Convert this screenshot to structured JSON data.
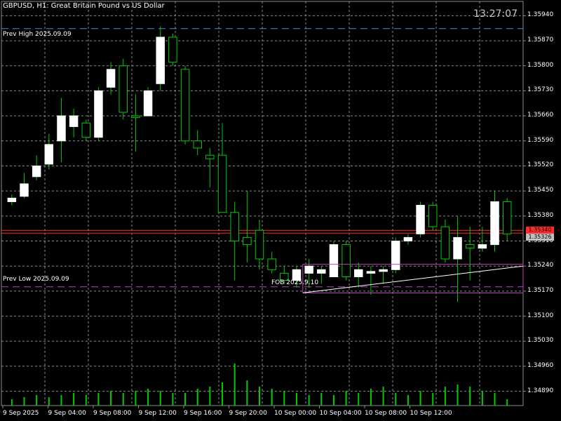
{
  "title": "GBPUSD, H1:  Great Britain Pound vs US Dollar",
  "clock": "13:27:07",
  "lines": {
    "prev_high": {
      "label": "Prev High 2025.09.09",
      "price": 1.35904,
      "color": "#4a86e8"
    },
    "prev_low": {
      "label": "Prev Low 2025.09.09",
      "price": 1.35182,
      "color": "#c040c0"
    },
    "fob": {
      "label": "FOB 2025.9.10"
    },
    "red_level": {
      "price": 1.3534,
      "color": "#ff2a2a"
    }
  },
  "price_axis": {
    "labels": [
      "1.35940",
      "1.35870",
      "1.35800",
      "1.35730",
      "1.35660",
      "1.35590",
      "1.35520",
      "1.35450",
      "1.35380",
      "1.35310",
      "1.35240",
      "1.35170",
      "1.35100",
      "1.35030",
      "1.34960",
      "1.34890"
    ],
    "tags": [
      {
        "text": "1.35340",
        "bg": "#ff2a2a"
      },
      {
        "text": "1.35326",
        "bg": "#c0c0c0"
      }
    ]
  },
  "time_axis": [
    "9 Sep 2025",
    "9 Sep 04:00",
    "9 Sep 08:00",
    "9 Sep 12:00",
    "9 Sep 16:00",
    "9 Sep 20:00",
    "10 Sep 00:00",
    "10 Sep 04:00",
    "10 Sep 08:00",
    "10 Sep 12:00"
  ],
  "colors": {
    "background": "#000000",
    "grid": "#8c8c8c",
    "bull_body": "#ffffff",
    "wick": "#00cc00",
    "volume": "#00cc00",
    "fob_line": "#ffffff"
  },
  "chart_data": {
    "type": "candlestick",
    "symbol": "GBPUSD",
    "timeframe": "H1",
    "price_range": [
      1.3485,
      1.3598
    ],
    "candles": [
      {
        "o": 1.3542,
        "h": 1.3544,
        "l": 1.3541,
        "c": 1.3543
      },
      {
        "o": 1.35435,
        "h": 1.355,
        "l": 1.3543,
        "c": 1.3547
      },
      {
        "o": 1.3549,
        "h": 1.3555,
        "l": 1.3548,
        "c": 1.3552
      },
      {
        "o": 1.35525,
        "h": 1.3561,
        "l": 1.3551,
        "c": 1.3558
      },
      {
        "o": 1.3559,
        "h": 1.3571,
        "l": 1.3553,
        "c": 1.3566
      },
      {
        "o": 1.3563,
        "h": 1.3568,
        "l": 1.356,
        "c": 1.3566
      },
      {
        "o": 1.3564,
        "h": 1.3565,
        "l": 1.3559,
        "c": 1.356
      },
      {
        "o": 1.356,
        "h": 1.3574,
        "l": 1.3559,
        "c": 1.3573
      },
      {
        "o": 1.3574,
        "h": 1.3581,
        "l": 1.3572,
        "c": 1.3579
      },
      {
        "o": 1.358,
        "h": 1.3582,
        "l": 1.3565,
        "c": 1.3567
      },
      {
        "o": 1.3566,
        "h": 1.3572,
        "l": 1.3556,
        "c": 1.35655
      },
      {
        "o": 1.3566,
        "h": 1.3574,
        "l": 1.3566,
        "c": 1.3573
      },
      {
        "o": 1.3575,
        "h": 1.3591,
        "l": 1.3573,
        "c": 1.3588
      },
      {
        "o": 1.3588,
        "h": 1.3589,
        "l": 1.358,
        "c": 1.3581
      },
      {
        "o": 1.3579,
        "h": 1.358,
        "l": 1.3558,
        "c": 1.3559
      },
      {
        "o": 1.3559,
        "h": 1.3562,
        "l": 1.3555,
        "c": 1.3557
      },
      {
        "o": 1.3555,
        "h": 1.3557,
        "l": 1.3546,
        "c": 1.3554
      },
      {
        "o": 1.3555,
        "h": 1.3564,
        "l": 1.3548,
        "c": 1.3539
      },
      {
        "o": 1.3539,
        "h": 1.3542,
        "l": 1.352,
        "c": 1.3531
      },
      {
        "o": 1.3532,
        "h": 1.3545,
        "l": 1.3525,
        "c": 1.353
      },
      {
        "o": 1.3534,
        "h": 1.3537,
        "l": 1.3523,
        "c": 1.3526
      },
      {
        "o": 1.3526,
        "h": 1.3528,
        "l": 1.3522,
        "c": 1.3523
      },
      {
        "o": 1.3522,
        "h": 1.3524,
        "l": 1.3519,
        "c": 1.352
      },
      {
        "o": 1.352,
        "h": 1.3524,
        "l": 1.3518,
        "c": 1.3523
      },
      {
        "o": 1.3522,
        "h": 1.3526,
        "l": 1.3518,
        "c": 1.3524
      },
      {
        "o": 1.3522,
        "h": 1.3524,
        "l": 1.3519,
        "c": 1.3523
      },
      {
        "o": 1.3521,
        "h": 1.3531,
        "l": 1.3521,
        "c": 1.353
      },
      {
        "o": 1.353,
        "h": 1.3531,
        "l": 1.352,
        "c": 1.3521
      },
      {
        "o": 1.3521,
        "h": 1.3525,
        "l": 1.3518,
        "c": 1.3523
      },
      {
        "o": 1.3522,
        "h": 1.3524,
        "l": 1.3516,
        "c": 1.35225
      },
      {
        "o": 1.35225,
        "h": 1.3524,
        "l": 1.3519,
        "c": 1.3523
      },
      {
        "o": 1.3523,
        "h": 1.3532,
        "l": 1.3522,
        "c": 1.3531
      },
      {
        "o": 1.3531,
        "h": 1.3533,
        "l": 1.353,
        "c": 1.3532
      },
      {
        "o": 1.3533,
        "h": 1.3542,
        "l": 1.3532,
        "c": 1.3541
      },
      {
        "o": 1.3541,
        "h": 1.3542,
        "l": 1.3534,
        "c": 1.3535
      },
      {
        "o": 1.3535,
        "h": 1.3537,
        "l": 1.3525,
        "c": 1.3526
      },
      {
        "o": 1.3526,
        "h": 1.3538,
        "l": 1.3514,
        "c": 1.3532
      },
      {
        "o": 1.353,
        "h": 1.3535,
        "l": 1.352,
        "c": 1.3529
      },
      {
        "o": 1.3529,
        "h": 1.3535,
        "l": 1.3528,
        "c": 1.353
      },
      {
        "o": 1.353,
        "h": 1.3545,
        "l": 1.3528,
        "c": 1.3542
      },
      {
        "o": 1.3542,
        "h": 1.3543,
        "l": 1.3531,
        "c": 1.3533
      }
    ],
    "volumes": [
      3,
      4,
      5,
      4,
      5,
      6,
      5,
      6,
      7,
      6,
      7,
      8,
      7,
      6,
      6,
      8,
      9,
      11,
      20,
      12,
      9,
      8,
      7,
      6,
      5,
      6,
      5,
      7,
      6,
      8,
      9,
      6,
      5,
      7,
      6,
      9,
      10,
      9,
      7,
      6,
      3
    ]
  }
}
